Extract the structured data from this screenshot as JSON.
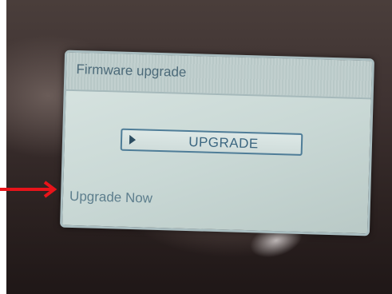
{
  "dialog": {
    "title": "Firmware upgrade",
    "button_label": "UPGRADE",
    "status_text": "Upgrade Now"
  },
  "icons": {
    "button_icon": "play-triangle-icon",
    "pointer": "red-arrow-icon"
  },
  "colors": {
    "screen_bg": "#cfdcda",
    "text": "#4c6a79",
    "button_border": "#4f7d98",
    "arrow": "#e8141a"
  }
}
